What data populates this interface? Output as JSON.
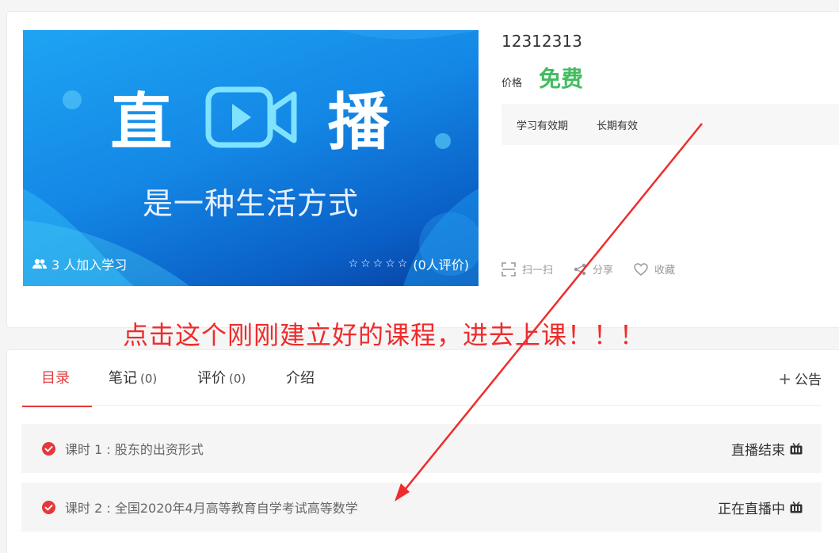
{
  "course": {
    "cover": {
      "headline_left": "直",
      "headline_right": "播",
      "subtitle": "是一种生活方式",
      "learners": "3 人加入学习",
      "stars": "☆☆☆☆☆",
      "rating_text": "(0人评价)"
    },
    "title": "12312313",
    "price_label": "价格",
    "price": "免费",
    "validity_label": "学习有效期",
    "validity_value": "长期有效",
    "actions": {
      "scan": "扫一扫",
      "share": "分享",
      "favorite": "收藏"
    }
  },
  "annotation": "点击这个刚刚建立好的课程，进去上课！！！",
  "tabs": [
    {
      "label": "目录",
      "count": ""
    },
    {
      "label": "笔记",
      "count": "(0)"
    },
    {
      "label": "评价",
      "count": "(0)"
    },
    {
      "label": "介绍",
      "count": ""
    }
  ],
  "announce": {
    "plus": "+",
    "label": "公告"
  },
  "lessons": [
    {
      "text": "课时 1 : 股东的出资形式",
      "status": "直播结束"
    },
    {
      "text": "课时 2 : 全国2020年4月高等教育自学考试高等数学",
      "status": "正在直播中"
    }
  ],
  "colors": {
    "accent_red": "#e4393c",
    "price_green": "#43bc60",
    "annotation_red": "#ee2c2c"
  },
  "icons": [
    "users-icon",
    "star-icon",
    "scan-icon",
    "share-icon",
    "heart-icon",
    "check-circle-icon",
    "tv-icon"
  ]
}
